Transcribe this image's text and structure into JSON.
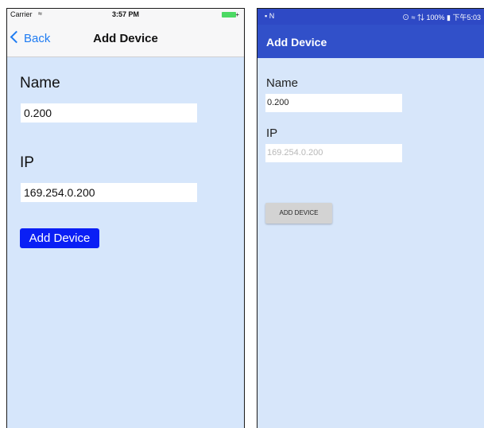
{
  "ios": {
    "status": {
      "carrier": "Carrier",
      "wifi_icon": "wifi-icon",
      "time": "3:57 PM",
      "battery_icon": "battery-icon",
      "battery_color": "#4cd964"
    },
    "nav": {
      "back_label": "Back",
      "title": "Add Device",
      "accent": "#1f7cf2"
    },
    "name_label": "Name",
    "name_value": "0.200",
    "ip_label": "IP",
    "ip_value": "169.254.0.200",
    "button_label": "Add Device",
    "button_color": "#0a1ff5"
  },
  "android": {
    "status": {
      "left_icons": "▪ N",
      "right_text": "⊙ ≈ ⇅ 100% ▮ 下午5:03"
    },
    "appbar_title": "Add Device",
    "appbar_color": "#3150c9",
    "name_label": "Name",
    "name_value": "0.200",
    "ip_label": "IP",
    "ip_placeholder": "169.254.0.200",
    "button_label": "ADD DEVICE"
  }
}
